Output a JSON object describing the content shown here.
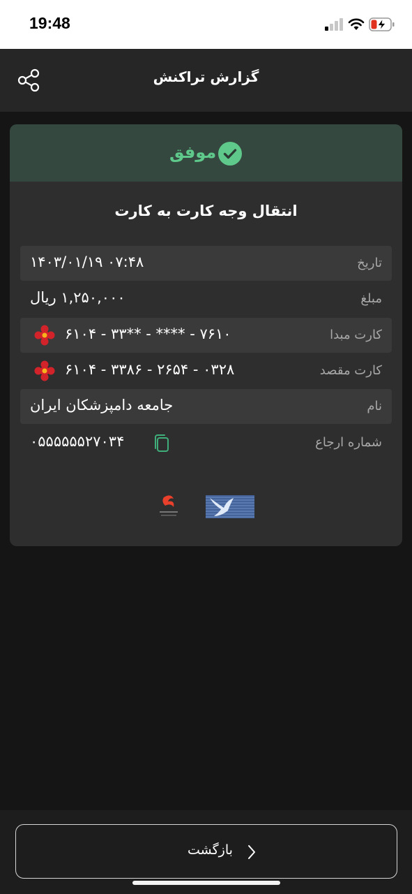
{
  "status_bar": {
    "time": "19:48"
  },
  "header": {
    "title": "گزارش تراکنش",
    "share_icon": "share-icon"
  },
  "card": {
    "status": "موفق",
    "status_color": "#5ec98a",
    "title": "انتقال وجه کارت به کارت",
    "rows": [
      {
        "label": "تاریخ",
        "value": "۱۴۰۳/۰۱/۱۹ ۰۷:۴۸"
      },
      {
        "label": "مبلغ",
        "value": "۱,۲۵۰,۰۰۰ ریال"
      },
      {
        "label": "کارت مبدا",
        "value": "۶۱۰۴ - ۳۳** - **** - ۷۶۱۰"
      },
      {
        "label": "کارت مقصد",
        "value": "۶۱۰۴ - ۳۳۸۶ - ۲۶۵۴ - ۰۳۲۸"
      },
      {
        "label": "نام",
        "value": "جامعه دامپزشکان ایران"
      },
      {
        "label": "شماره ارجاع",
        "value": "۰۵۵۵۵۵۵۲۷۰۳۴"
      }
    ]
  },
  "footer": {
    "back_label": "بازگشت"
  },
  "colors": {
    "background": "#151515",
    "card": "#2e2e2e",
    "banner": "#34483f",
    "accent_green": "#5ec98a",
    "bank_red": "#d2232a"
  }
}
